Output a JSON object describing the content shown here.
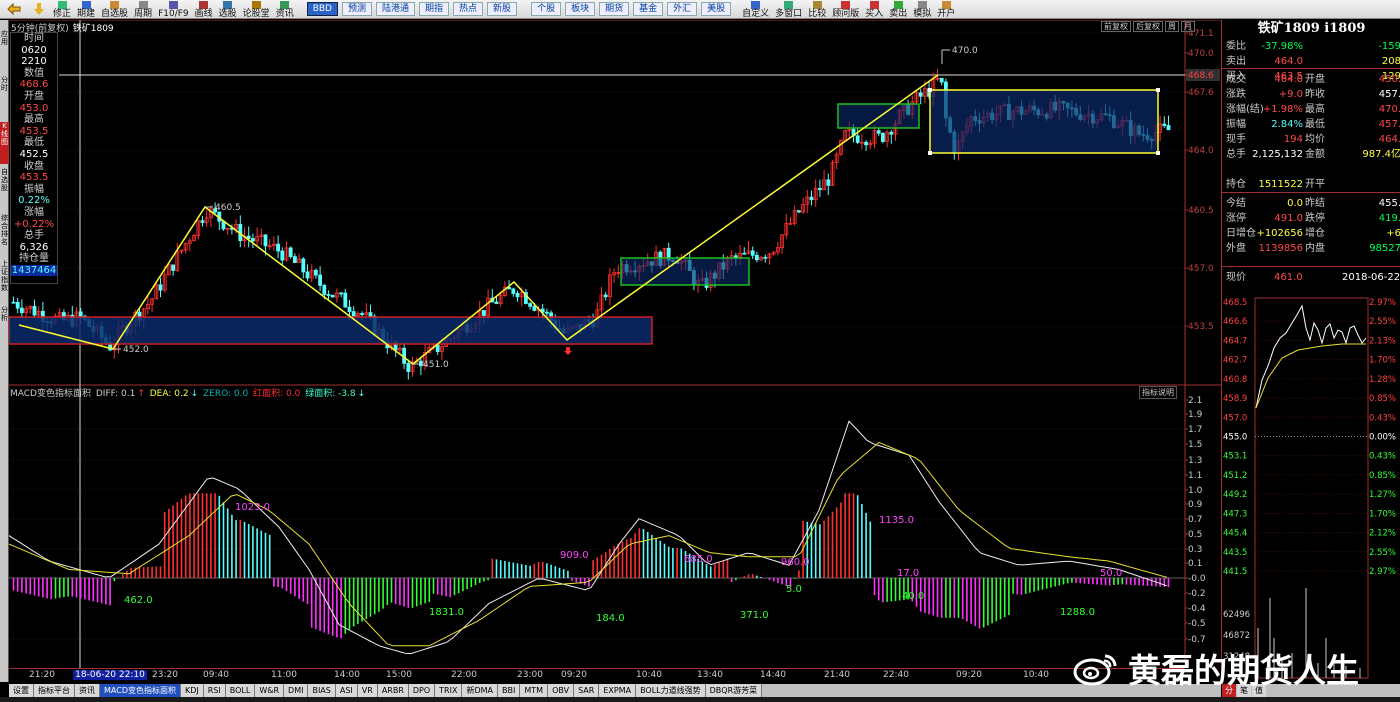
{
  "toolbar": {
    "items": [
      "修正",
      "期建",
      "自选股",
      "周期",
      "F10/F9",
      "画线",
      "选股",
      "论股堂",
      "资讯"
    ],
    "tabs": [
      "BBD",
      "预测",
      "陆港通",
      "期指",
      "热点",
      "新股"
    ],
    "tabs2": [
      "个股",
      "板块",
      "期货",
      "基金",
      "外汇",
      "美股"
    ],
    "items2": [
      "自定义",
      "多窗口",
      "比较",
      "顾问版",
      "买入",
      "卖出",
      "模拟",
      "开户"
    ]
  },
  "leftstrip": [
    "应用",
    "分时",
    "K线图",
    "自选股",
    "综合排名",
    "上证指数",
    "分析"
  ],
  "chart": {
    "title_left": "5分钟(前复权)",
    "title_symbol": "铁矿1809",
    "tabs": [
      "前复权",
      "后复权",
      "周",
      "月"
    ],
    "price_axis": [
      "471.1",
      "470.0",
      "468.6",
      "467.6",
      "464.0",
      "460.5",
      "457.0",
      "453.5"
    ],
    "price_annotations": {
      "hi1": "460.5",
      "lo1": "452.0",
      "lo2": "451.0",
      "hi2": "470.0"
    },
    "macd_axis": [
      "2.1",
      "1.9",
      "1.7",
      "1.5",
      "1.3",
      "1.1",
      "1.0",
      "0.9",
      "0.7",
      "0.5",
      "0.3",
      "0.1",
      "-0.0",
      "-0.2",
      "-0.4",
      "-0.5",
      "-0.7"
    ],
    "macd_labels": [
      "1023.0",
      "462.0",
      "1831.0",
      "909.0",
      "184.0",
      "685.0",
      "371.0",
      "960.0",
      "5.0",
      "1135.0",
      "17.0",
      "40.0",
      "50.0",
      "1288.0"
    ],
    "x_labels": [
      "21:20",
      "18-06-20 22:10",
      "23:20",
      "09:40",
      "11:00",
      "14:00",
      "15:00",
      "22:00",
      "23:00",
      "09:20",
      "10:40",
      "13:40",
      "14:40",
      "21:40",
      "22:40",
      "09:20",
      "10:40"
    ]
  },
  "infobox": {
    "l_time": "时间",
    "v_time1": "0620",
    "v_time2": "2210",
    "l_val": "数值",
    "v_val": "468.6",
    "l_open": "开盘",
    "v_open": "453.0",
    "l_high": "最高",
    "v_high": "453.5",
    "l_low": "最低",
    "v_low": "452.5",
    "l_close": "收盘",
    "v_close": "453.5",
    "l_amp": "振幅",
    "v_amp": "0.22%",
    "l_chg": "涨幅",
    "v_chg": "+0.22%",
    "l_vol": "总手",
    "v_vol": "6,326",
    "l_oi": "持仓量",
    "v_oi": "1437464"
  },
  "macd_header": {
    "name": "MACD变色指标面积",
    "diff": "DIFF: 0.1",
    "dea": "DEA: 0.2",
    "zero": "ZERO: 0.0",
    "red_area": "红面积: 0.0",
    "green_area": "绿面积: -3.8",
    "help": "指标说明"
  },
  "bottom_tabs": [
    "设置",
    "指标平台",
    "资讯",
    "MACD变色指标面积",
    "KDJ",
    "RSI",
    "BOLL",
    "W&R",
    "DMI",
    "BIAS",
    "ASI",
    "VR",
    "ARBR",
    "DPO",
    "TRIX",
    "新DMA",
    "BBI",
    "MTM",
    "OBV",
    "SAR",
    "EXPMA",
    "BOLL力道线强势",
    "DBQR游芳菜"
  ],
  "quote": {
    "title": "铁矿1809 i1809",
    "rows": [
      {
        "l": "委比",
        "v": "-37.98%",
        "vc": "grn",
        "l2": "",
        "v2": "-159",
        "v2c": "grn"
      },
      {
        "l": "卖出",
        "v": "464.0",
        "vc": "red",
        "l2": "",
        "v2": "208",
        "v2c": "yel"
      },
      {
        "l": "买入",
        "v": "463.5",
        "vc": "red",
        "l2": "",
        "v2": "129",
        "v2c": "yel"
      },
      {
        "l": "成交",
        "v": "464.0",
        "vc": "red",
        "l2": "开盘",
        "v2": "450.",
        "v2c": "red"
      },
      {
        "l": "涨跌",
        "v": "+9.0",
        "vc": "red",
        "l2": "昨收",
        "v2": "457.",
        "v2c": "wht"
      },
      {
        "l": "涨幅(结)",
        "v": "+1.98%",
        "vc": "red",
        "l2": "最高",
        "v2": "470.",
        "v2c": "red"
      },
      {
        "l": "振幅",
        "v": "2.84%",
        "vc": "cyan",
        "l2": "最低",
        "v2": "457.",
        "v2c": "red"
      },
      {
        "l": "现手",
        "v": "194",
        "vc": "red",
        "l2": "均价",
        "v2": "464.",
        "v2c": "red"
      },
      {
        "l": "总手",
        "v": "2,125,132",
        "vc": "wht",
        "l2": "金额",
        "v2": "987.4亿",
        "v2c": "yel"
      },
      {
        "l": "持仓",
        "v": "1511522",
        "vc": "yel",
        "l2": "开平",
        "v2": "",
        "v2c": "wht"
      },
      {
        "l": "今结",
        "v": "0.0",
        "vc": "yel",
        "l2": "昨结",
        "v2": "455.",
        "v2c": "wht"
      },
      {
        "l": "涨停",
        "v": "491.0",
        "vc": "red",
        "l2": "跌停",
        "v2": "419.",
        "v2c": "grn"
      },
      {
        "l": "日增仓",
        "v": "+102656",
        "vc": "yel",
        "l2": "增仓",
        "v2": "+6",
        "v2c": "yel"
      },
      {
        "l": "外盘",
        "v": "1139856",
        "vc": "red",
        "l2": "内盘",
        "v2": "98527",
        "v2c": "grn"
      }
    ],
    "now_label": "现价",
    "now_value": "461.0",
    "now_date": "2018-06-22",
    "mini_left": [
      "468.5",
      "466.6",
      "464.7",
      "462.7",
      "460.8",
      "458.9",
      "457.0",
      "455.0",
      "453.1",
      "451.2",
      "449.2",
      "447.3",
      "445.4",
      "443.5",
      "441.5"
    ],
    "mini_right": [
      "2.97%",
      "2.55%",
      "2.13%",
      "1.70%",
      "1.28%",
      "0.85%",
      "0.43%",
      "0.00%",
      "0.43%",
      "0.85%",
      "1.27%",
      "1.70%",
      "2.12%",
      "2.55%",
      "2.97%"
    ],
    "mini_vol": [
      "62496",
      "46872",
      "31248"
    ],
    "tabs": [
      "分",
      "笔",
      "值"
    ]
  },
  "watermark": "黄磊的期货人生"
}
